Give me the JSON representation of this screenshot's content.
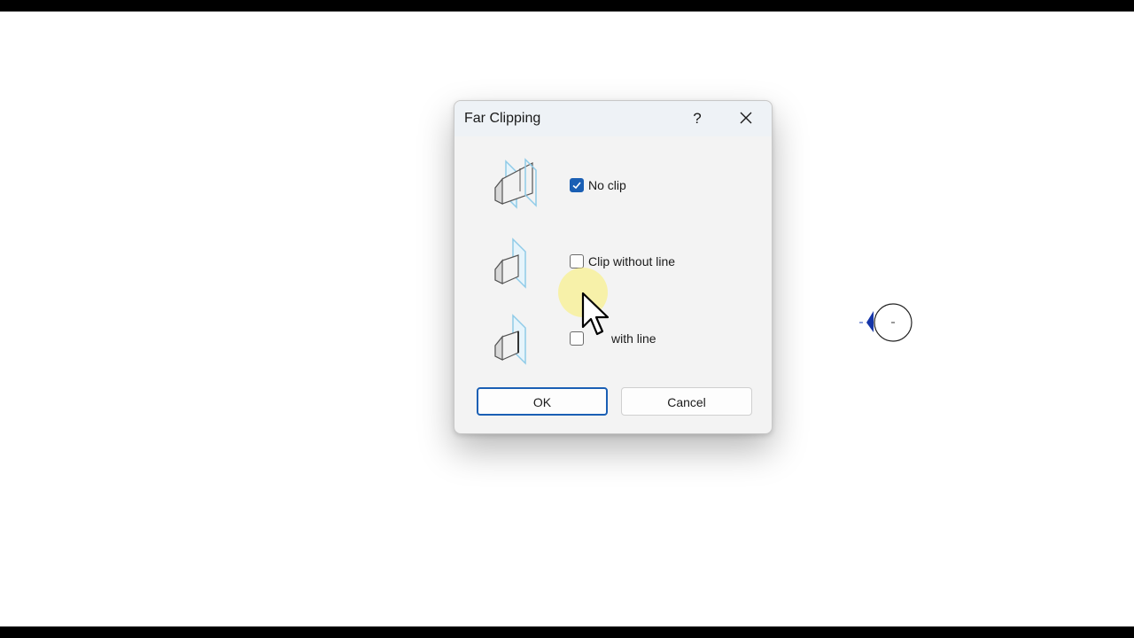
{
  "dialog": {
    "title": "Far Clipping",
    "help_label": "?",
    "options": [
      {
        "label": "No clip",
        "checked": true,
        "illustration": "no-clip-illustration"
      },
      {
        "label": "Clip without line",
        "checked": false,
        "illustration": "clip-without-line-illustration"
      },
      {
        "label": "with line",
        "checked": false,
        "illustration": "clip-with-line-illustration"
      }
    ],
    "ok_label": "OK",
    "cancel_label": "Cancel"
  },
  "colors": {
    "accent": "#1a5fb4",
    "dialog_bg": "#f3f3f3",
    "titlebar_bg": "#eef2f6",
    "cursor_highlight": "#faf078",
    "plane": "#8fcbe8"
  },
  "icons": [
    "close-icon",
    "help-icon",
    "checkmark-icon",
    "mouse-pointer-icon",
    "section-head-icon"
  ]
}
